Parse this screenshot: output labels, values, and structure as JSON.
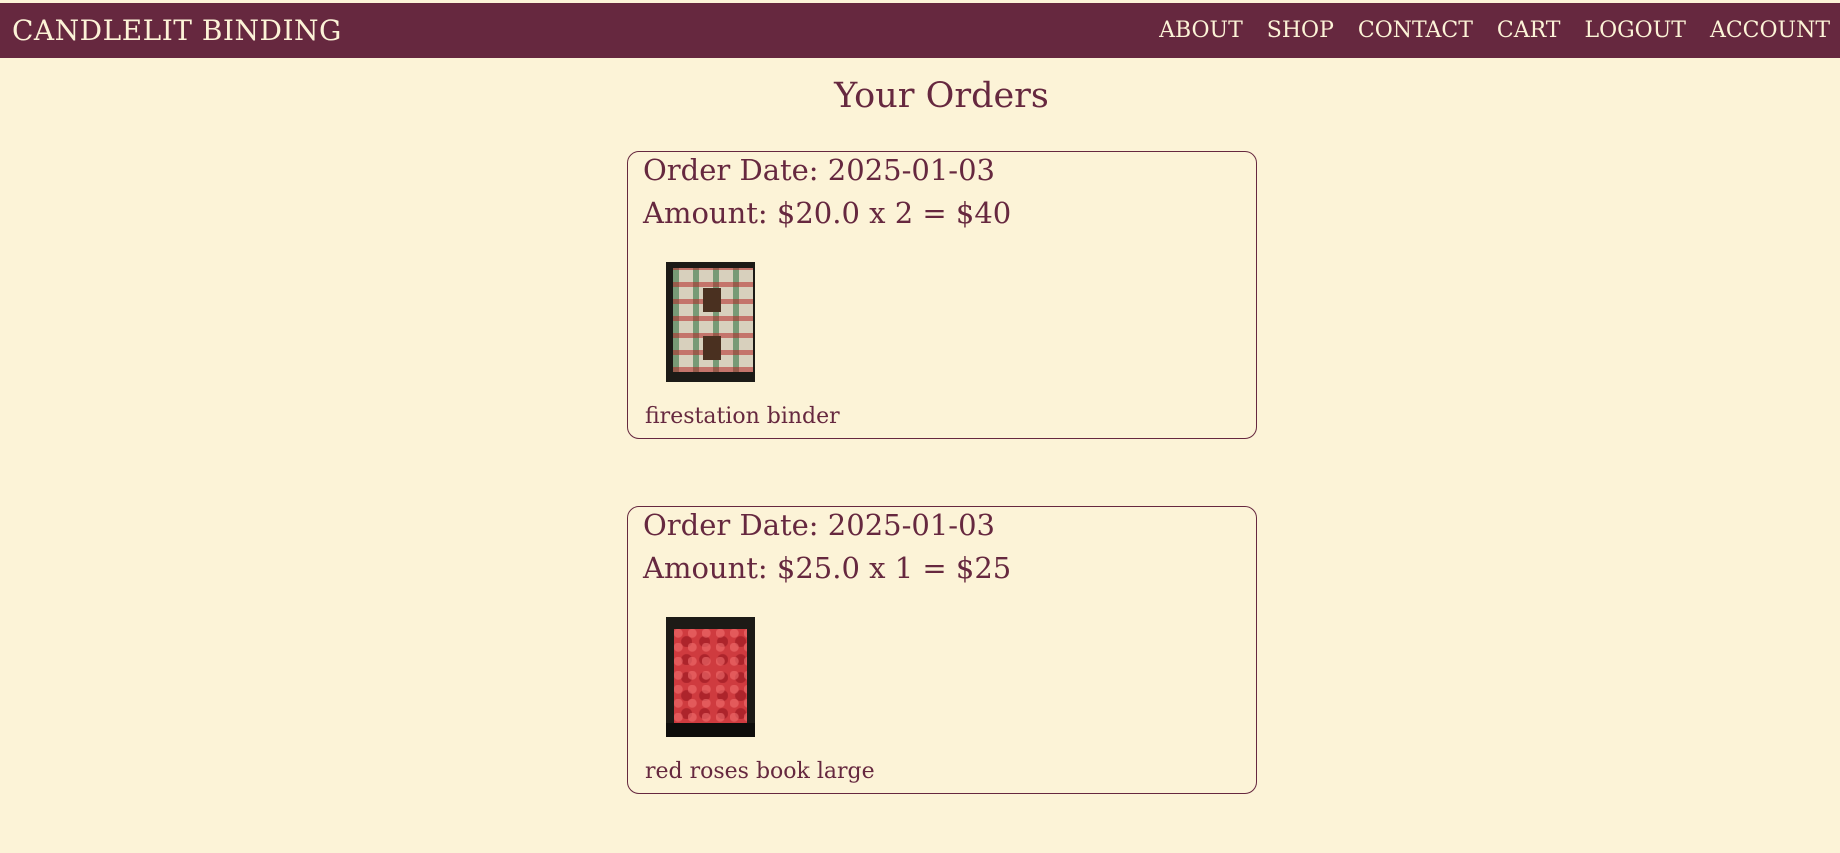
{
  "navbar": {
    "brand": "CANDLELIT BINDING",
    "links": [
      "ABOUT",
      "SHOP",
      "CONTACT",
      "CART",
      "LOGOUT",
      "ACCOUNT"
    ]
  },
  "page": {
    "title": "Your Orders"
  },
  "orders": [
    {
      "date_text": "Order Date: 2025-01-03",
      "amount_text": "Amount: $20.0 x 2 = $40",
      "product_name": "firestation binder"
    },
    {
      "date_text": "Order Date: 2025-01-03",
      "amount_text": "Amount: $25.0 x 1 = $25",
      "product_name": "red roses book large"
    }
  ],
  "colors": {
    "background": "#fcf3d7",
    "navbar": "#66283f",
    "text": "#66283f",
    "nav_text": "#fcf3d7"
  }
}
